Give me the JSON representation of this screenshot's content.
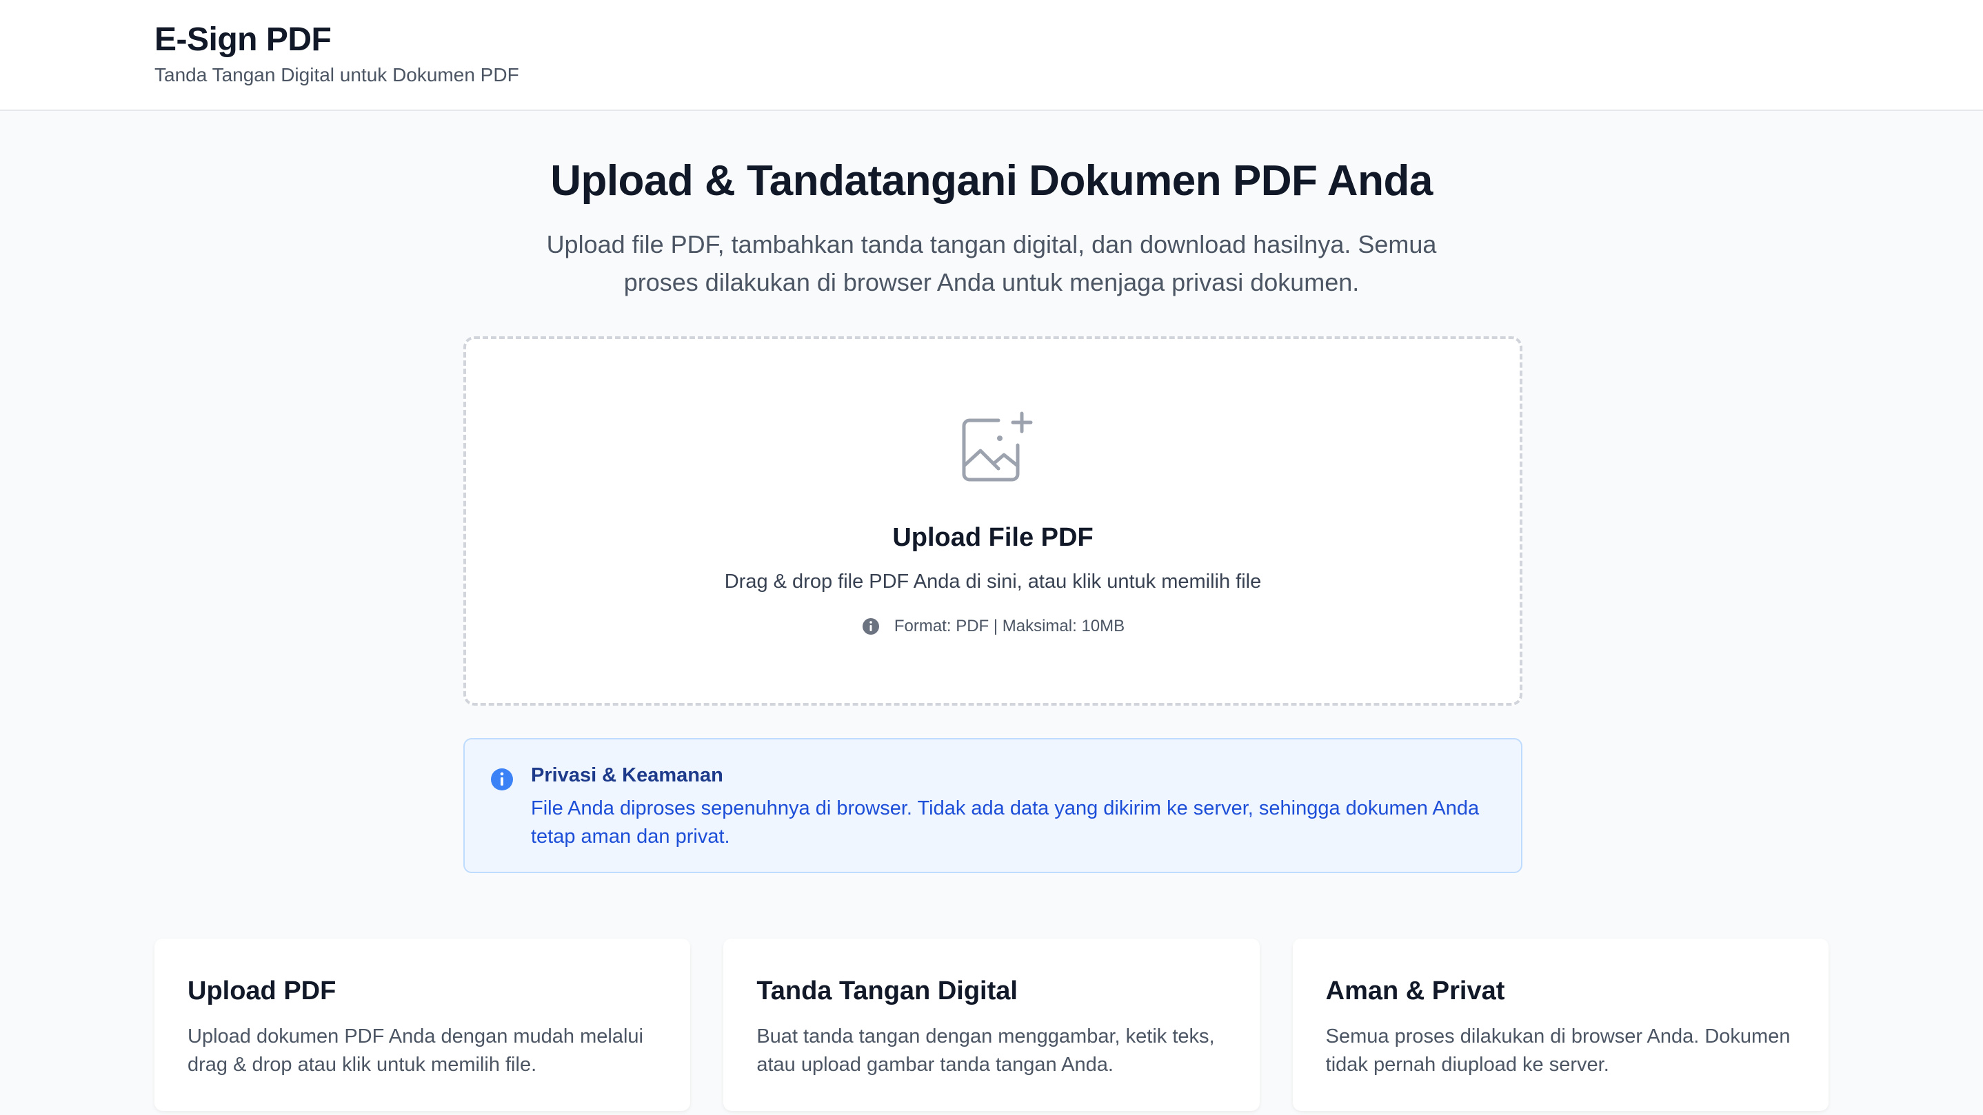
{
  "header": {
    "title": "E-Sign PDF",
    "subtitle": "Tanda Tangan Digital untuk Dokumen PDF"
  },
  "hero": {
    "title": "Upload & Tandatangani Dokumen PDF Anda",
    "description": "Upload file PDF, tambahkan tanda tangan digital, dan download hasilnya. Semua proses dilakukan di browser Anda untuk menjaga privasi dokumen."
  },
  "upload": {
    "icon": "image-plus-icon",
    "title": "Upload File PDF",
    "description": "Drag & drop file PDF Anda di sini, atau klik untuk memilih file",
    "meta": "Format: PDF | Maksimal: 10MB"
  },
  "privacy": {
    "title": "Privasi & Keamanan",
    "text": "File Anda diproses sepenuhnya di browser. Tidak ada data yang dikirim ke server, sehingga dokumen Anda tetap aman dan privat."
  },
  "features": [
    {
      "title": "Upload PDF",
      "description": "Upload dokumen PDF Anda dengan mudah melalui drag & drop atau klik untuk memilih file."
    },
    {
      "title": "Tanda Tangan Digital",
      "description": "Buat tanda tangan dengan menggambar, ketik teks, atau upload gambar tanda tangan Anda."
    },
    {
      "title": "Aman & Privat",
      "description": "Semua proses dilakukan di browser Anda. Dokumen tidak pernah diupload ke server."
    }
  ],
  "colors": {
    "background": "#f9fafb",
    "info_blue": "#1d4ed8",
    "info_bg": "#eff6ff",
    "info_border": "#bfdbfe"
  }
}
